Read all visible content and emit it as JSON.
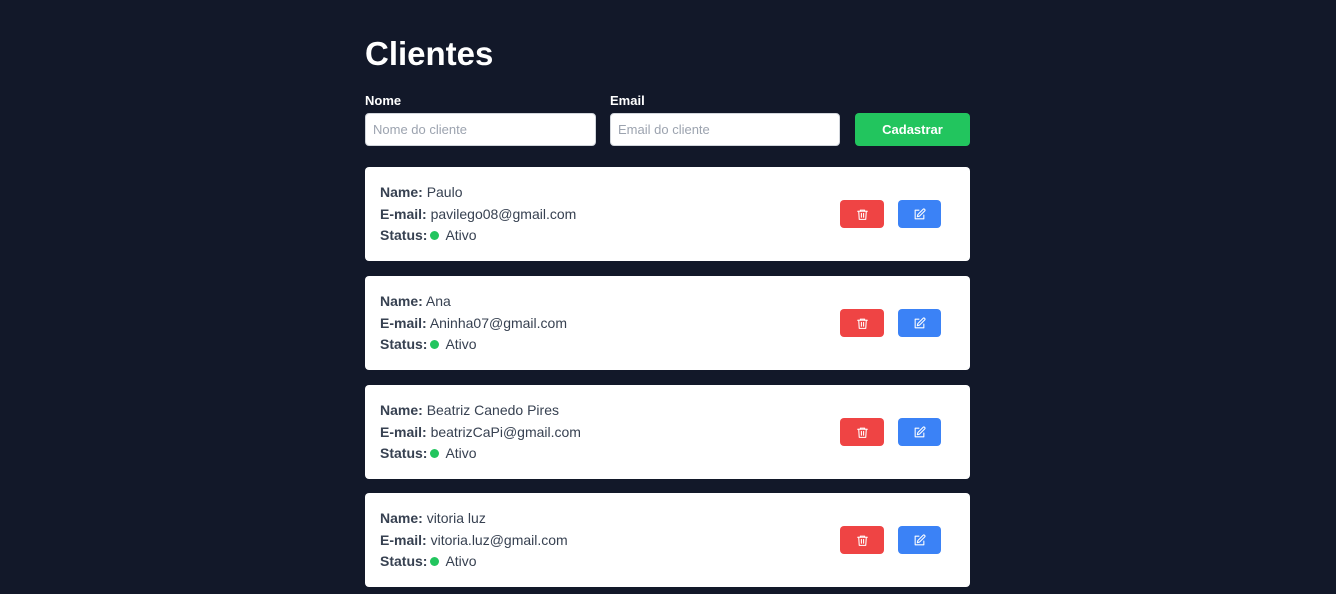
{
  "page": {
    "title": "Clientes"
  },
  "form": {
    "name_label": "Nome",
    "name_placeholder": "Nome do cliente",
    "name_value": "",
    "email_label": "Email",
    "email_placeholder": "Email do cliente",
    "email_value": "",
    "submit_label": "Cadastrar"
  },
  "labels": {
    "name": "Name:",
    "email": "E-mail:",
    "status": "Status:"
  },
  "clients": [
    {
      "name": "Paulo",
      "email": "pavilego08@gmail.com",
      "status": "Ativo"
    },
    {
      "name": "Ana",
      "email": "Aninha07@gmail.com",
      "status": "Ativo"
    },
    {
      "name": "Beatriz Canedo Pires",
      "email": "beatrizCaPi@gmail.com",
      "status": "Ativo"
    },
    {
      "name": "vitoria luz",
      "email": "vitoria.luz@gmail.com",
      "status": "Ativo"
    }
  ],
  "icons": {
    "delete": "trash-icon",
    "edit": "edit-icon",
    "status": "status-dot"
  },
  "colors": {
    "background": "#121829",
    "submit": "#22c55e",
    "delete": "#ef4444",
    "edit": "#3b82f6",
    "status_active": "#22c55e"
  }
}
